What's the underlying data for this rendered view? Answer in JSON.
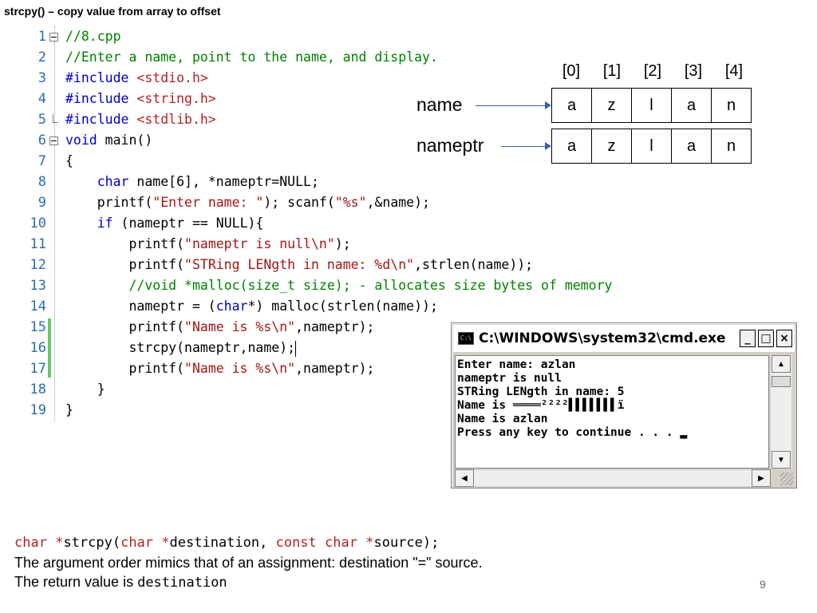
{
  "slide": {
    "title": "strcpy() – copy value from array to offset",
    "page_number": "9"
  },
  "code": {
    "line_numbers": [
      "1",
      "2",
      "3",
      "4",
      "5",
      "6",
      "7",
      "8",
      "9",
      "10",
      "11",
      "12",
      "13",
      "14",
      "15",
      "16",
      "17",
      "18",
      "19"
    ],
    "lines": [
      {
        "n": "1",
        "segments": [
          {
            "t": "//8.cpp",
            "c": "cm"
          }
        ]
      },
      {
        "n": "2",
        "segments": [
          {
            "t": "//Enter a name, point to the name, and display.",
            "c": "cm"
          }
        ]
      },
      {
        "n": "3",
        "segments": [
          {
            "t": "#include ",
            "c": "kw"
          },
          {
            "t": "<stdio.h>",
            "c": "st2"
          }
        ]
      },
      {
        "n": "4",
        "segments": [
          {
            "t": "#include ",
            "c": "kw"
          },
          {
            "t": "<string.h>",
            "c": "st2"
          }
        ]
      },
      {
        "n": "5",
        "segments": [
          {
            "t": "#include ",
            "c": "kw"
          },
          {
            "t": "<stdlib.h>",
            "c": "st2"
          }
        ]
      },
      {
        "n": "6",
        "segments": [
          {
            "t": "void",
            "c": "kw"
          },
          {
            "t": " main()",
            "c": ""
          }
        ]
      },
      {
        "n": "7",
        "segments": [
          {
            "t": "{",
            "c": ""
          }
        ]
      },
      {
        "n": "8",
        "segments": [
          {
            "t": "    ",
            "c": ""
          },
          {
            "t": "char",
            "c": "kw"
          },
          {
            "t": " name[6], *nameptr=NULL;",
            "c": ""
          }
        ]
      },
      {
        "n": "9",
        "segments": [
          {
            "t": "    printf(",
            "c": ""
          },
          {
            "t": "\"Enter name: \"",
            "c": "st"
          },
          {
            "t": "); scanf(",
            "c": ""
          },
          {
            "t": "\"%s\"",
            "c": "st"
          },
          {
            "t": ",&name);",
            "c": ""
          }
        ]
      },
      {
        "n": "10",
        "segments": [
          {
            "t": "    ",
            "c": ""
          },
          {
            "t": "if",
            "c": "kw"
          },
          {
            "t": " (nameptr == NULL){",
            "c": ""
          }
        ]
      },
      {
        "n": "11",
        "segments": [
          {
            "t": "        printf(",
            "c": ""
          },
          {
            "t": "\"nameptr is null\\n\"",
            "c": "st"
          },
          {
            "t": ");",
            "c": ""
          }
        ]
      },
      {
        "n": "12",
        "segments": [
          {
            "t": "        printf(",
            "c": ""
          },
          {
            "t": "\"STRing LENgth in name: %d\\n\"",
            "c": "st"
          },
          {
            "t": ",strlen(name));",
            "c": ""
          }
        ]
      },
      {
        "n": "13",
        "segments": [
          {
            "t": "        ",
            "c": ""
          },
          {
            "t": "//void *malloc(size_t size); - allocates size bytes of memory",
            "c": "cm"
          }
        ]
      },
      {
        "n": "14",
        "segments": [
          {
            "t": "        nameptr = (",
            "c": ""
          },
          {
            "t": "char",
            "c": "kw"
          },
          {
            "t": "*) malloc(strlen(name));",
            "c": ""
          }
        ]
      },
      {
        "n": "15",
        "segments": [
          {
            "t": "        printf(",
            "c": ""
          },
          {
            "t": "\"Name is %s\\n\"",
            "c": "st"
          },
          {
            "t": ",nameptr);",
            "c": ""
          }
        ]
      },
      {
        "n": "16",
        "segments": [
          {
            "t": "        strcpy(nameptr,name);",
            "c": ""
          }
        ]
      },
      {
        "n": "17",
        "segments": [
          {
            "t": "        printf(",
            "c": ""
          },
          {
            "t": "\"Name is %s\\n\"",
            "c": "st"
          },
          {
            "t": ",nameptr);",
            "c": ""
          }
        ]
      },
      {
        "n": "18",
        "segments": [
          {
            "t": "    }",
            "c": ""
          }
        ]
      },
      {
        "n": "19",
        "segments": [
          {
            "t": "}",
            "c": ""
          }
        ]
      }
    ]
  },
  "diagram": {
    "indices": [
      "[0]",
      "[1]",
      "[2]",
      "[3]",
      "[4]"
    ],
    "rows": [
      {
        "label": "name",
        "cells": [
          "a",
          "z",
          "l",
          "a",
          "n"
        ]
      },
      {
        "label": "nameptr",
        "cells": [
          "a",
          "z",
          "l",
          "a",
          "n"
        ]
      }
    ]
  },
  "console": {
    "title": "C:\\WINDOWS\\system32\\cmd.exe",
    "icon_text": "C:\\",
    "minimize": "_",
    "maximize": "□",
    "close": "×",
    "output": "Enter name: azlan\nnameptr is null\nSTRing LENgth in name: 5\nName is ════²²²²▌▌▌▌▌▌▌ï\nName is azlan\nPress any key to continue . . . ▂",
    "scroll_up": "▲",
    "scroll_down": "▼",
    "scroll_left": "◀",
    "scroll_right": "▶"
  },
  "footer": {
    "proto_segments": [
      {
        "t": "char",
        "c": "r"
      },
      {
        "t": " *",
        "c": "r"
      },
      {
        "t": "strcpy(",
        "c": ""
      },
      {
        "t": "char",
        "c": "r"
      },
      {
        "t": " *",
        "c": "r"
      },
      {
        "t": "destination, ",
        "c": ""
      },
      {
        "t": "const",
        "c": "r"
      },
      {
        "t": " ",
        "c": ""
      },
      {
        "t": "char",
        "c": "r"
      },
      {
        "t": " *",
        "c": "r"
      },
      {
        "t": "source);",
        "c": ""
      }
    ],
    "line2": "The argument order mimics that of an assignment: destination \"=\" source.",
    "line3_prefix": "The return value is ",
    "line3_code": "destination"
  },
  "colors": {
    "keyword": "#0000c8",
    "comment": "#008000",
    "string": "#a31515",
    "arrow": "#3a5fa8"
  }
}
